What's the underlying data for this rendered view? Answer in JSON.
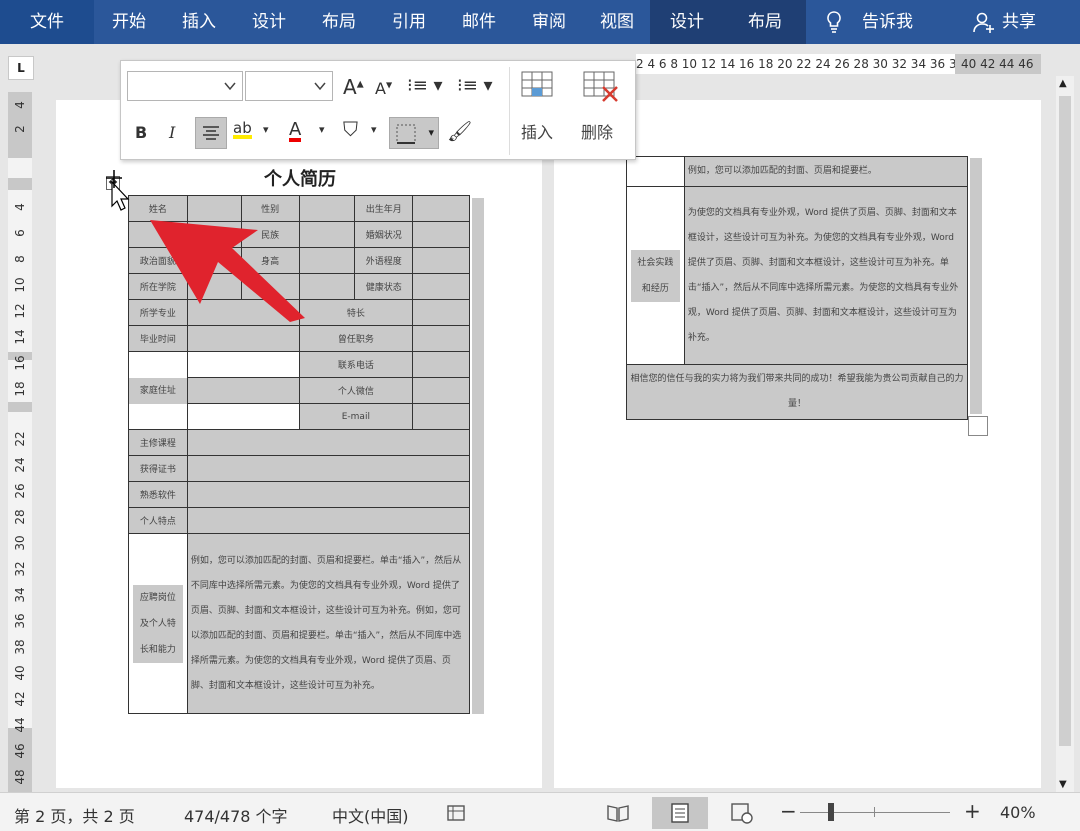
{
  "ribbon": {
    "tabs": [
      "文件",
      "开始",
      "插入",
      "设计",
      "布局",
      "引用",
      "邮件",
      "审阅",
      "视图"
    ],
    "context_tabs": [
      "设计",
      "布局"
    ],
    "tell_me": "告诉我",
    "share": "共享"
  },
  "ruler": {
    "corner": "L",
    "top_numbers": "2  4  6  8 10 12 14 16 18 20 22 24 26 28 30 32 34 36 3",
    "top_numbers_end": "40 42 44 46",
    "side_numbers": [
      "4",
      "2",
      "4",
      "6",
      "8",
      "10",
      "12",
      "14",
      "16",
      "18",
      "22",
      "24",
      "26",
      "28",
      "30",
      "32",
      "34",
      "36",
      "38",
      "40",
      "42",
      "44",
      "46",
      "48"
    ]
  },
  "mini_toolbar": {
    "font_name": "",
    "font_size": "",
    "bold": "B",
    "italic": "I",
    "insert_label": "插入",
    "delete_label": "删除"
  },
  "doc": {
    "title": "个人简历",
    "rows": {
      "name": "姓名",
      "gender": "性别",
      "birth": "出生年月",
      "ethnic": "民族",
      "marital": "婚姻状况",
      "political": "政治面貌",
      "height": "身高",
      "foreign": "外语程度",
      "hometown": "所在学院",
      "health": "健康状态",
      "major": "所学专业",
      "specialty": "特长",
      "grad_time": "毕业时间",
      "position": "曾任职务",
      "phone": "联系电话",
      "address": "家庭住址",
      "wechat": "个人微信",
      "email": "E-mail",
      "courses": "主修课程",
      "certs": "获得证书",
      "software": "熟悉软件",
      "traits": "个人特点",
      "apply": "应聘岗位及个人特长和能力",
      "apply_text": "例如，您可以添加匹配的封面、页眉和提要栏。单击“插入”，然后从不同库中选择所需元素。为使您的文档具有专业外观，Word 提供了页眉、页脚、封面和文本框设计，这些设计可互为补充。例如，您可以添加匹配的封面、页眉和提要栏。单击“插入”，然后从不同库中选择所需元素。为使您的文档具有专业外观，Word 提供了页眉、页脚、封面和文本框设计，这些设计可互为补充。"
    },
    "page2": {
      "line1": "例如，您可以添加匹配的封面、页眉和提要栏。",
      "social_label": "社会实践和经历",
      "social_text": "为使您的文档具有专业外观，Word 提供了页眉、页脚、封面和文本框设计，这些设计可互为补充。为使您的文档具有专业外观，Word 提供了页眉、页脚、封面和文本框设计，这些设计可互为补充。单击“插入”，然后从不同库中选择所需元素。为使您的文档具有专业外观，Word 提供了页眉、页脚、封面和文本框设计，这些设计可互为补充。",
      "closing": "相信您的信任与我的实力将为我们带来共同的成功！希望我能为贵公司贡献自己的力量！"
    }
  },
  "status": {
    "page": "第 2 页，共 2 页",
    "words": "474/478 个字",
    "language": "中文(中国)",
    "zoom": "40%",
    "zoom_minus": "−",
    "zoom_plus": "+"
  },
  "colors": {
    "ribbon": "#2b579a",
    "context_tab": "#1f3f74",
    "arrow": "#e0232d",
    "cell_gray": "#c9c9c9"
  }
}
